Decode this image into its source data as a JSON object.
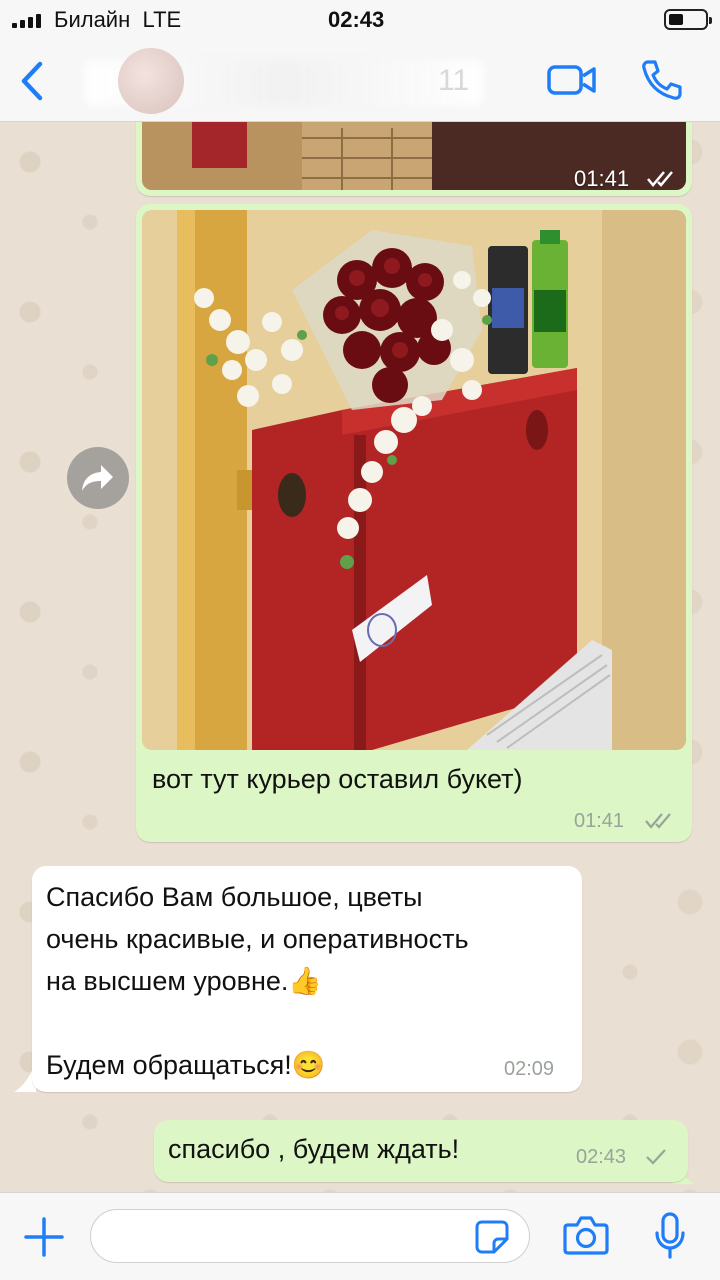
{
  "status_bar": {
    "carrier": "Билайн",
    "network": "LTE",
    "time": "02:43"
  },
  "header": {
    "contact_digits": "11",
    "icons": [
      "back-chevron-icon",
      "video-call-icon",
      "phone-icon"
    ]
  },
  "messages": [
    {
      "type": "photo",
      "direction": "outgoing",
      "time": "01:41",
      "status": "read"
    },
    {
      "type": "photo",
      "direction": "outgoing",
      "caption": "вот тут курьер оставил букет)",
      "time": "01:41",
      "status": "read"
    },
    {
      "type": "text",
      "direction": "incoming",
      "lines": [
        "Спасибо Вам большое, цветы",
        "очень красивые, и оперативность",
        "на высшем уровне."
      ],
      "emoji_1": "👍",
      "line_last": "Будем обращаться!",
      "emoji_2": "😊",
      "time": "02:09"
    },
    {
      "type": "text",
      "direction": "outgoing",
      "text": "спасибо , будем ждать!",
      "time": "02:43",
      "status": "sent"
    }
  ],
  "composer": {
    "placeholder": "",
    "icons": [
      "plus-icon",
      "sticker-icon",
      "camera-icon",
      "microphone-icon"
    ]
  },
  "colors": {
    "accent": "#1f7ef7",
    "outgoing_bubble": "#dcf7c5",
    "incoming_bubble": "#ffffff",
    "chat_background": "#e9dfd2",
    "read_tick": "#8fa08f"
  }
}
